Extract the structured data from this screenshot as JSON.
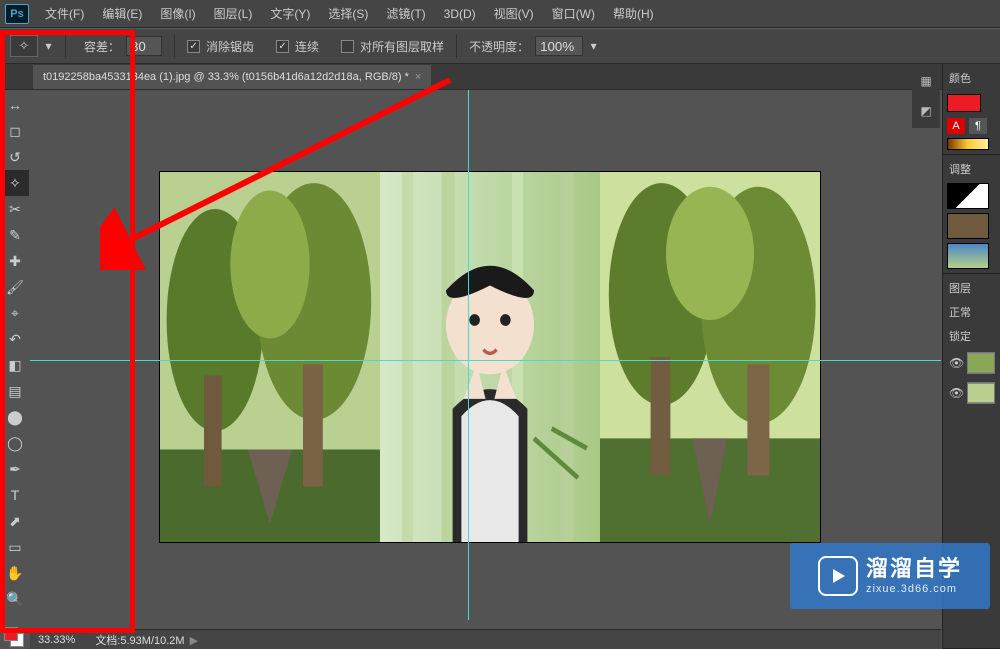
{
  "menu": {
    "items": [
      "文件(F)",
      "编辑(E)",
      "图像(I)",
      "图层(L)",
      "文字(Y)",
      "选择(S)",
      "滤镜(T)",
      "3D(D)",
      "视图(V)",
      "窗口(W)",
      "帮助(H)"
    ]
  },
  "options": {
    "tolerance_label": "容差：",
    "tolerance_value": "30",
    "antialias": "消除锯齿",
    "contiguous": "连续",
    "sample_all": "对所有图层取样",
    "opacity_label": "不透明度：",
    "opacity_value": "100%"
  },
  "tab": {
    "title": "t0192258ba4533134ea (1).jpg @ 33.3% (t0156b41d6a12d2d18a, RGB/8) *"
  },
  "tools": [
    {
      "name": "move-tool",
      "icon": "↔"
    },
    {
      "name": "rect-marquee-tool",
      "icon": "◻"
    },
    {
      "name": "lasso-tool",
      "icon": "↺"
    },
    {
      "name": "magic-wand-tool",
      "icon": "✧",
      "active": true
    },
    {
      "name": "crop-tool",
      "icon": "✂"
    },
    {
      "name": "eyedropper-tool",
      "icon": "✎"
    },
    {
      "name": "healing-brush-tool",
      "icon": "✚"
    },
    {
      "name": "brush-tool",
      "icon": "🖌"
    },
    {
      "name": "clone-stamp-tool",
      "icon": "⌖"
    },
    {
      "name": "history-brush-tool",
      "icon": "↶"
    },
    {
      "name": "eraser-tool",
      "icon": "◧"
    },
    {
      "name": "gradient-tool",
      "icon": "▤"
    },
    {
      "name": "blur-tool",
      "icon": "⬤"
    },
    {
      "name": "dodge-tool",
      "icon": "◯"
    },
    {
      "name": "pen-tool",
      "icon": "✒"
    },
    {
      "name": "type-tool",
      "icon": "T"
    },
    {
      "name": "path-select-tool",
      "icon": "⬈"
    },
    {
      "name": "rectangle-tool",
      "icon": "▭"
    },
    {
      "name": "hand-tool",
      "icon": "✋"
    },
    {
      "name": "zoom-tool",
      "icon": "🔍"
    }
  ],
  "panels": {
    "color_label": "颜色",
    "adjustments_label": "调整",
    "layers_label": "图层",
    "blend_mode": "正常",
    "lock_label": "锁定"
  },
  "status": {
    "zoom": "33.33%",
    "doc_label": "文档:",
    "doc_size": "5.93M/10.2M"
  },
  "watermark": {
    "title": "溜溜自学",
    "sub": "zixue.3d66.com"
  }
}
